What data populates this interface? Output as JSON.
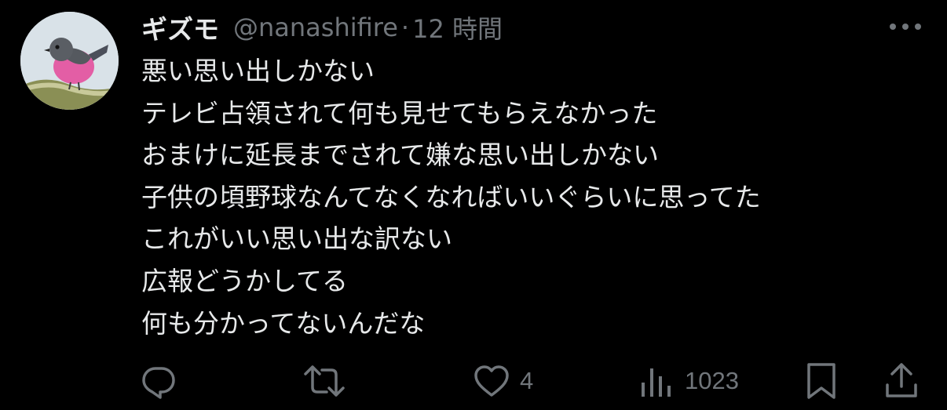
{
  "author": {
    "display_name": "ギズモ",
    "handle": "@nanashifire",
    "separator": "·",
    "time": "12 時間"
  },
  "body_lines": [
    "悪い思い出しかない",
    "テレビ占領されて何も見せてもらえなかった",
    "おまけに延長までされて嫌な思い出しかない",
    "子供の頃野球なんてなくなればいいぐらいに思ってた",
    "これがいい思い出な訳ない",
    "広報どうかしてる",
    "何も分かってないんだな"
  ],
  "actions": {
    "likes_count": "4",
    "views_count": "1023"
  },
  "colors": {
    "background": "#000000",
    "text": "#e7e9ea",
    "secondary": "#71767b"
  },
  "icons": {
    "more": "more-horizontal-icon",
    "reply": "reply-icon",
    "retweet": "retweet-icon",
    "like": "heart-icon",
    "views": "views-icon",
    "bookmark": "bookmark-icon",
    "share": "share-icon"
  }
}
